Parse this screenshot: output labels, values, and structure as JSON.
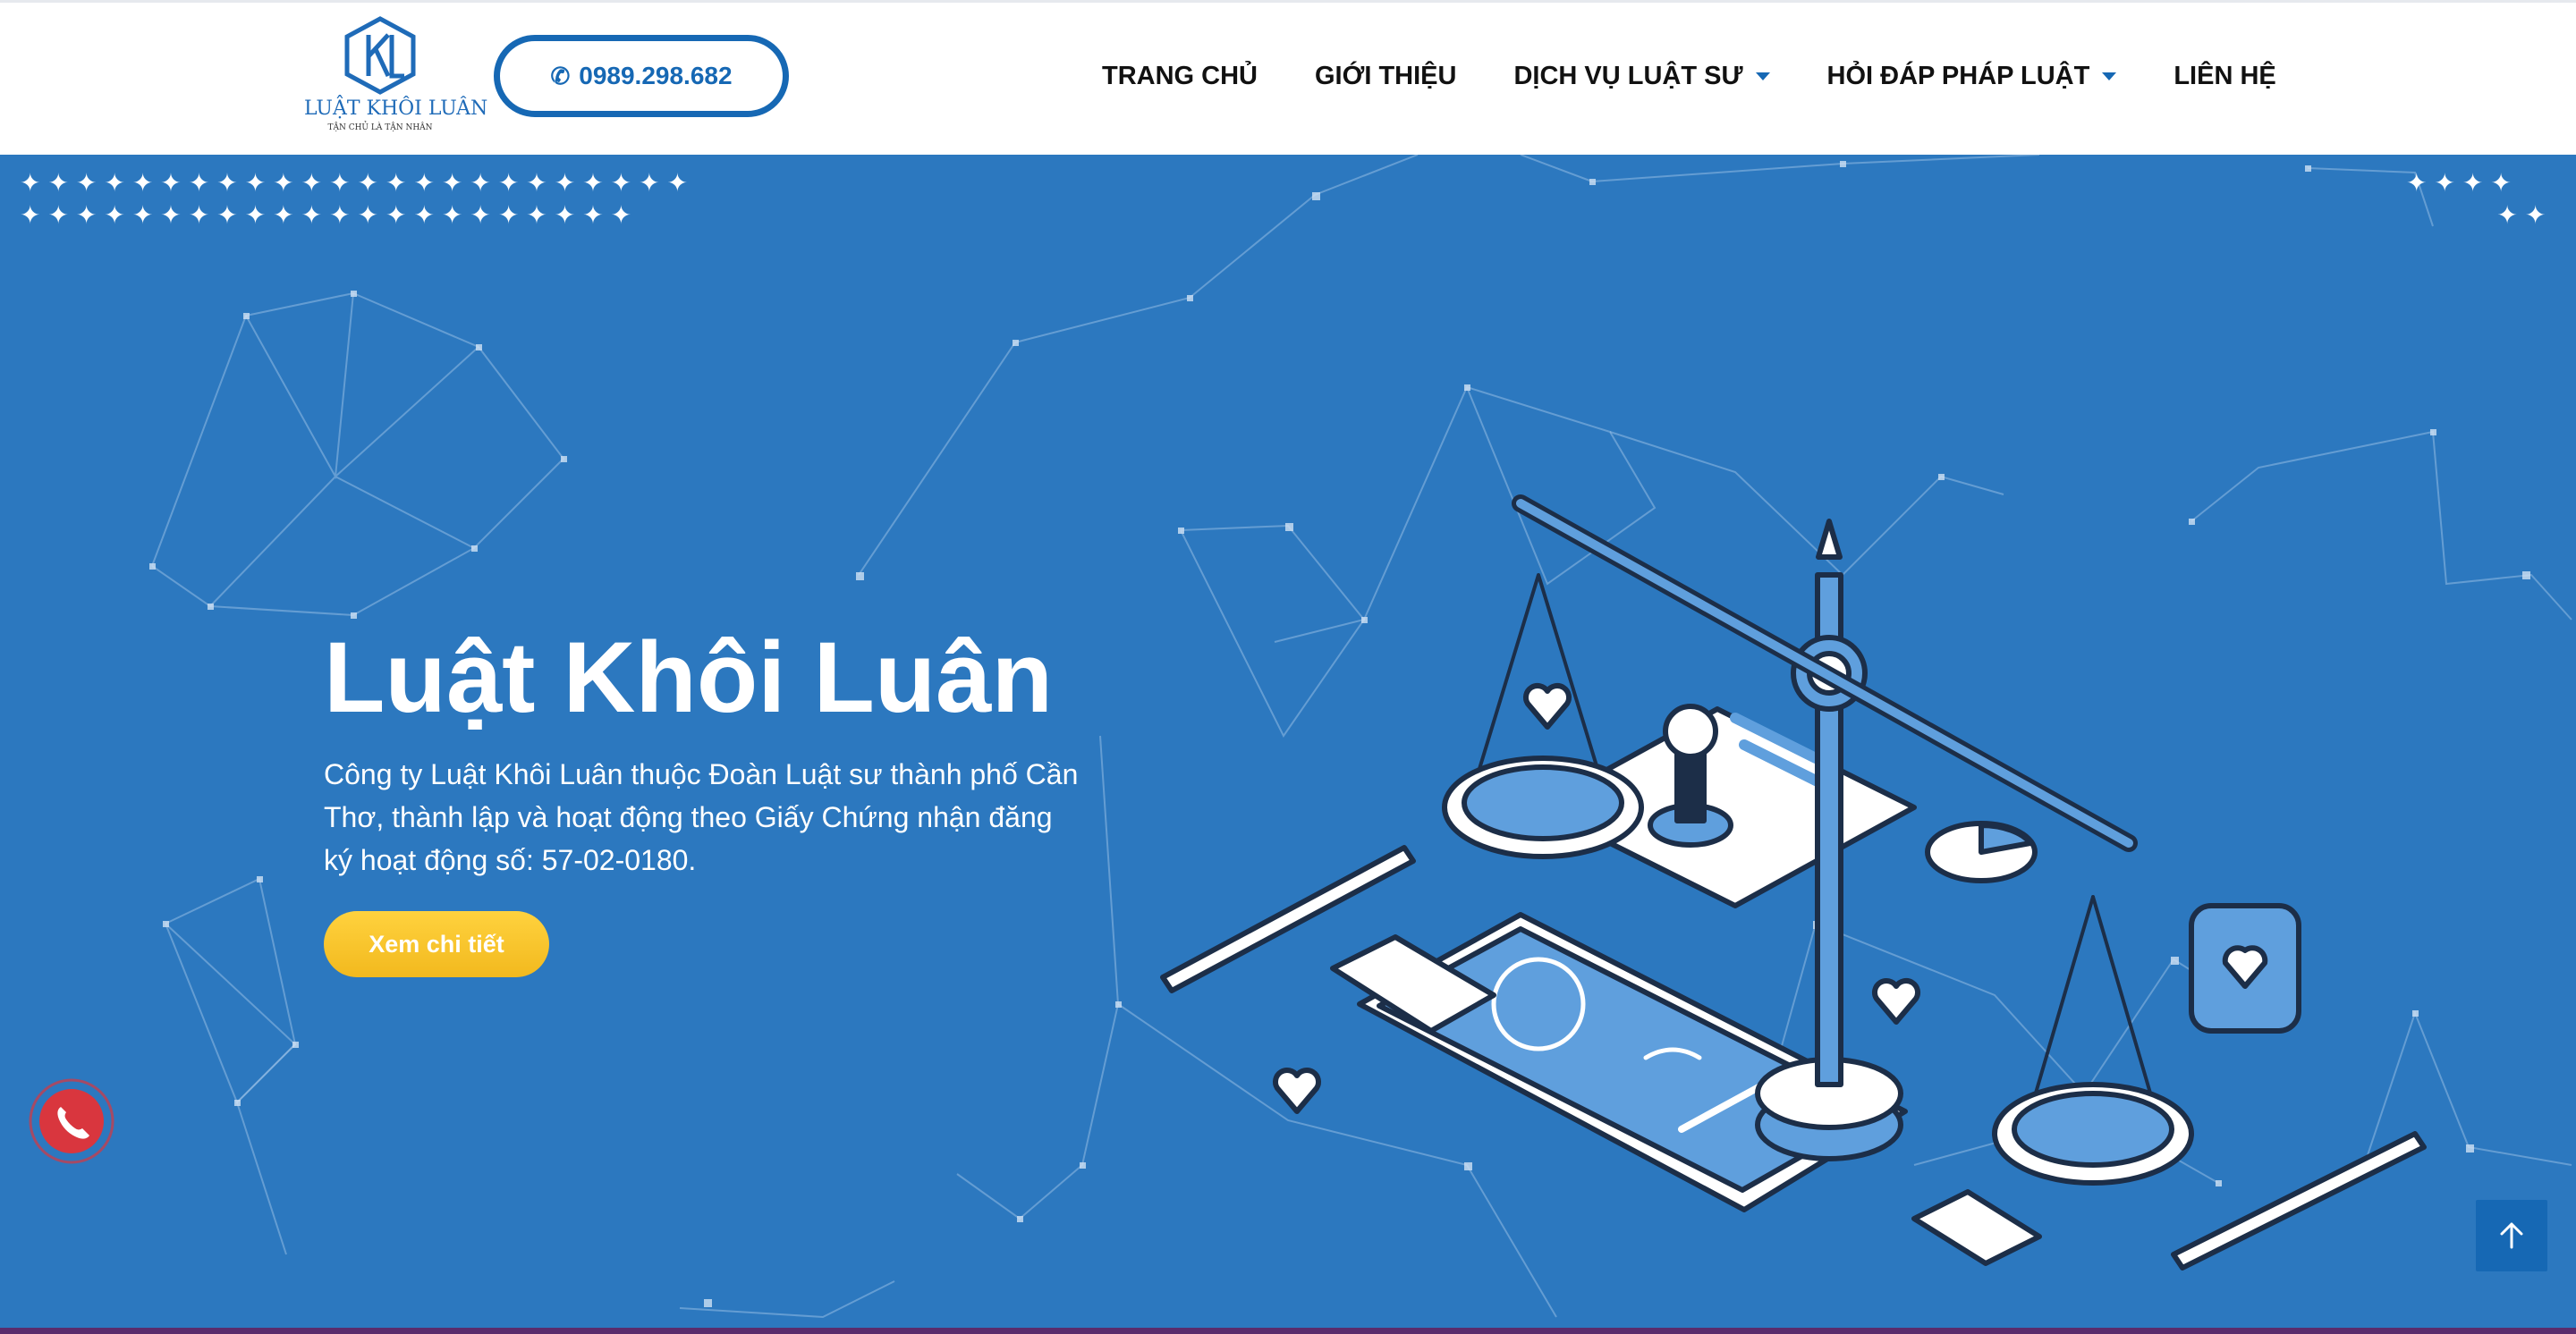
{
  "header": {
    "logo": {
      "name": "LUẬT KHÔI LUÂN",
      "slogan": "TẬN CHỦ LÀ TẬN NHÂN",
      "icon": "kl-hexagon-logo"
    },
    "phone_label": "0989.298.682",
    "nav": [
      {
        "label": "TRANG CHỦ",
        "has_dropdown": false
      },
      {
        "label": "GIỚI THIỆU",
        "has_dropdown": false
      },
      {
        "label": "DỊCH VỤ LUẬT SƯ",
        "has_dropdown": true
      },
      {
        "label": "HỎI ĐÁP PHÁP LUẬT",
        "has_dropdown": true
      },
      {
        "label": "LIÊN HỆ",
        "has_dropdown": false
      }
    ]
  },
  "hero": {
    "title": "Luật Khôi Luân",
    "description": "Công ty Luật Khôi Luân thuộc Đoàn Luật sư thành phố Cần Thơ, thành lập và hoạt động theo Giấy Chứng nhận đăng ký hoạt động số: 57-02-0180.",
    "cta_label": "Xem chi tiết",
    "illustration": "scales-of-justice-icon"
  },
  "floating": {
    "call_icon": "phone-icon",
    "scroll_top_icon": "arrow-up-icon"
  },
  "colors": {
    "primary": "#1668b4",
    "hero_bg": "#2c78bf",
    "cta": "#f7c22a",
    "call_button": "#d9363e"
  }
}
